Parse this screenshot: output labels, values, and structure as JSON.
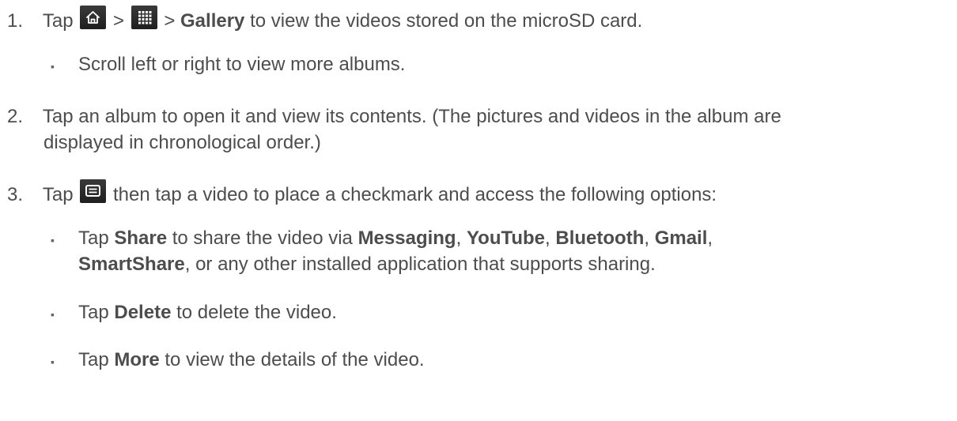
{
  "steps": [
    {
      "num": "1.",
      "tap": "Tap",
      "sep1": ">",
      "sep2": ">",
      "bold": "Gallery",
      "rest": "to view the videos stored on the microSD card.",
      "icons": [
        "home-icon",
        "apps-grid-icon"
      ]
    },
    {
      "num": "2.",
      "line1": "Tap an album to open it and view its contents. (The pictures and videos in the album are",
      "line2": "displayed in chronological order.)"
    },
    {
      "num": "3.",
      "tap": "Tap",
      "rest": "then tap a video to place a checkmark and access the following options:",
      "icons": [
        "menu-icon"
      ]
    }
  ],
  "sub1": {
    "bullet": "▪",
    "text": "Scroll left or right to view more albums."
  },
  "options": [
    {
      "bullet": "▪",
      "tap": "Tap",
      "bold": "Share",
      "mid": "to share the video via",
      "apps": [
        "Messaging",
        "YouTube",
        "Bluetooth",
        "Gmail"
      ],
      "line2_bold": "SmartShare",
      "line2_rest": ", or any other installed application that supports sharing."
    },
    {
      "bullet": "▪",
      "tap": "Tap",
      "bold": "Delete",
      "rest": "to delete the video."
    },
    {
      "bullet": "▪",
      "tap": "Tap",
      "bold": "More",
      "rest": "to view the details of the video."
    }
  ]
}
